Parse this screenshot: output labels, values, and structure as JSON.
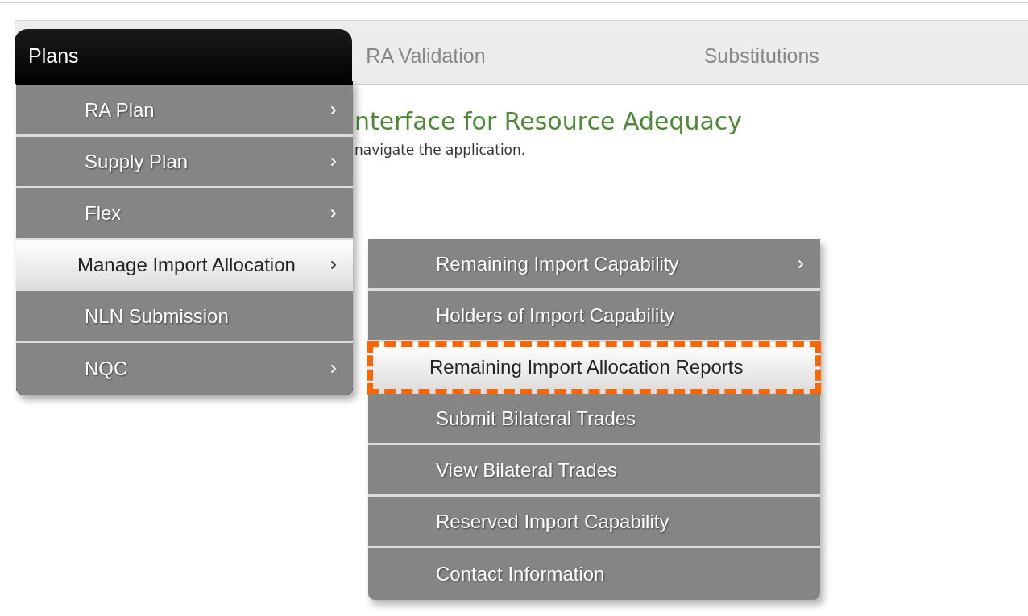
{
  "tabs": [
    {
      "label": "Plans",
      "selected": true
    },
    {
      "label": "RA Validation",
      "selected": false
    },
    {
      "label": "Substitutions",
      "selected": false
    }
  ],
  "welcome": {
    "heading": "nterface for Resource Adequacy",
    "text": "navigate the application."
  },
  "menu": {
    "items": [
      {
        "label": "RA Plan",
        "has_submenu": true,
        "selected": false
      },
      {
        "label": "Supply Plan",
        "has_submenu": true,
        "selected": false
      },
      {
        "label": "Flex",
        "has_submenu": true,
        "selected": false
      },
      {
        "label": "Manage Import Allocation",
        "has_submenu": true,
        "selected": true,
        "children": [
          {
            "label": "Remaining Import Capability",
            "has_submenu": true,
            "selected": false,
            "highlighted": false
          },
          {
            "label": "Holders of Import Capability",
            "has_submenu": false,
            "selected": false,
            "highlighted": false
          },
          {
            "label": "Remaining Import Allocation Reports",
            "has_submenu": false,
            "selected": true,
            "highlighted": true
          },
          {
            "label": "Submit Bilateral Trades",
            "has_submenu": false,
            "selected": false,
            "highlighted": false
          },
          {
            "label": "View Bilateral Trades",
            "has_submenu": false,
            "selected": false,
            "highlighted": false
          },
          {
            "label": "Reserved Import Capability",
            "has_submenu": false,
            "selected": false,
            "highlighted": false
          },
          {
            "label": "Contact Information",
            "has_submenu": false,
            "selected": false,
            "highlighted": false
          }
        ]
      },
      {
        "label": "NLN Submission",
        "has_submenu": false,
        "selected": false
      },
      {
        "label": "NQC",
        "has_submenu": true,
        "selected": false
      }
    ]
  }
}
